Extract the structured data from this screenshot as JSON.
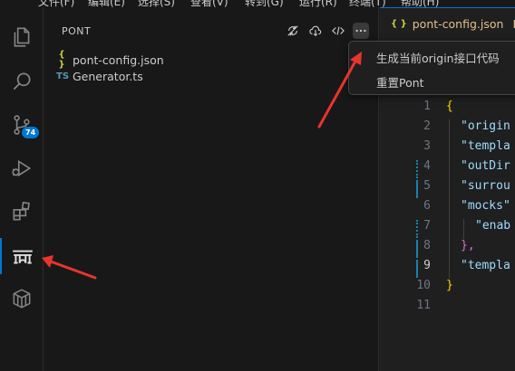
{
  "menubar": {
    "items": [
      "文件(F)",
      "编辑(E)",
      "选择(S)",
      "查看(V)",
      "转到(G)",
      "运行(R)",
      "终端(T)",
      "帮助(H)"
    ]
  },
  "activity": {
    "scm_badge": "74"
  },
  "sidebar": {
    "title": "PONT",
    "files": [
      {
        "icon": "{ }",
        "name": "pont-config.json",
        "icon_color": "#cbcb41"
      },
      {
        "icon": "TS",
        "name": "Generator.ts",
        "icon_color": "#519aba"
      }
    ]
  },
  "context_menu": {
    "items": [
      "生成当前origin接口代码",
      "重置Pont"
    ]
  },
  "editor": {
    "tab": {
      "icon": "{ }",
      "label": "pont-config.json",
      "modified": "M"
    },
    "line_numbers": [
      "1",
      "2",
      "3",
      "4",
      "5",
      "6",
      "7",
      "8",
      "9",
      "10",
      "11"
    ],
    "lines": [
      {
        "text": "{",
        "color": "#ffd700"
      },
      {
        "text": "\"origin",
        "color": "#9cdcfe"
      },
      {
        "text": "\"templa",
        "color": "#9cdcfe"
      },
      {
        "text": "\"outDir",
        "color": "#9cdcfe"
      },
      {
        "text": "\"surrou",
        "color": "#9cdcfe"
      },
      {
        "text": "\"mocks\"",
        "color": "#9cdcfe"
      },
      {
        "text": "\"enab",
        "color": "#9cdcfe"
      },
      {
        "text": "},",
        "color": "#da70d6"
      },
      {
        "text": "\"templa",
        "color": "#9cdcfe"
      },
      {
        "text": "}",
        "color": "#ffd700"
      },
      {
        "text": "",
        "color": "#cccccc"
      }
    ]
  },
  "colors": {
    "accent": "#0078d4",
    "annotation_arrow": "#e8352b"
  }
}
